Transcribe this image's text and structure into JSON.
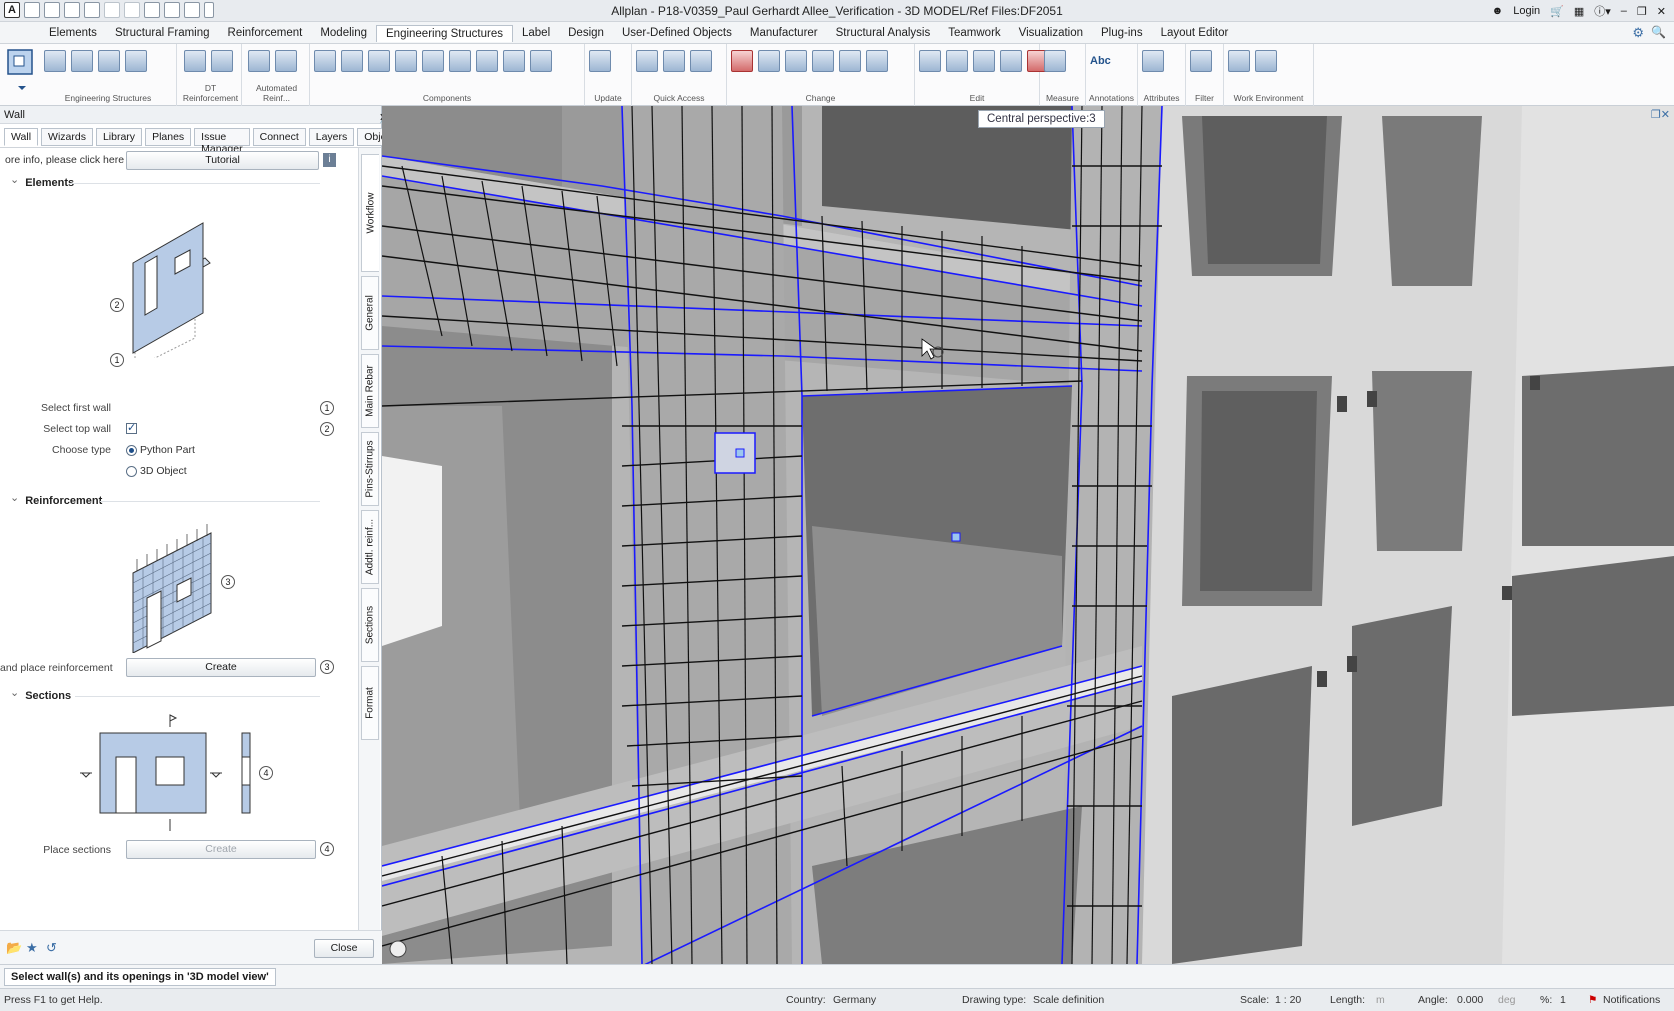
{
  "window": {
    "title": "Allplan - P18-V0359_Paul Gerhardt Allee_Verification - 3D MODEL/Ref Files:DF2051",
    "login": "Login"
  },
  "menu": {
    "tabs": [
      "Elements",
      "Structural Framing",
      "Reinforcement",
      "Modeling",
      "Engineering Structures",
      "Label",
      "Design",
      "User-Defined Objects",
      "Manufacturer",
      "Structural Analysis",
      "Teamwork",
      "Visualization",
      "Plug-ins",
      "Layout Editor"
    ],
    "active_index": 4
  },
  "ribbon": {
    "groups": [
      "Engineering Structures",
      "DT Reinforcement",
      "Automated Reinf...",
      "Components",
      "Update",
      "Quick Access",
      "Change",
      "Edit",
      "Measure",
      "Annotations",
      "Attributes",
      "Filter",
      "Work Environment"
    ],
    "annotation_text": "Abc"
  },
  "palette": {
    "title": "Wall",
    "tabs": [
      "Wall",
      "Wizards",
      "Library",
      "Planes",
      "Issue Manager",
      "Connect",
      "Layers",
      "Objects"
    ],
    "side_tabs": [
      "Workflow",
      "General",
      "Main Rebar",
      "Pins-Stirrups",
      "Addtl. reinf...",
      "Sections",
      "Format"
    ],
    "info_text": "ore info, please click here",
    "tutorial_button": "Tutorial",
    "sections": {
      "elements": "Elements",
      "reinforcement": "Reinforcement",
      "sections": "Sections"
    },
    "elements": {
      "select_first_wall": "Select first wall",
      "select_top_wall": "Select top wall",
      "select_top_wall_checked": true,
      "choose_type": "Choose type",
      "type_options": [
        "Python Part",
        "3D Object"
      ],
      "selected_type": "Python Part"
    },
    "reinforcement": {
      "label": "and place reinforcement",
      "button": "Create"
    },
    "sections_block": {
      "label": "Place sections",
      "button": "Create"
    },
    "step_numbers": [
      "1",
      "2",
      "3",
      "4"
    ],
    "close_button": "Close"
  },
  "viewport": {
    "view_label": "Central perspective:3"
  },
  "prompt": {
    "text": "Select wall(s) and its openings in '3D model view'"
  },
  "status": {
    "help": "Press F1 to get Help.",
    "country_label": "Country:",
    "country": "Germany",
    "drawing_type_label": "Drawing type:",
    "drawing_type": "Scale definition",
    "scale_label": "Scale:",
    "scale": "1 : 20",
    "length_label": "Length:",
    "length_unit": "m",
    "angle_label": "Angle:",
    "angle": "0.000",
    "angle_unit": "deg",
    "percent_label": "%:",
    "percent": "1",
    "notifications": "Notifications"
  },
  "colors": {
    "selection_blue": "#1a1aff",
    "concrete_light": "#e4e4e4",
    "concrete_dark": "#8a8a8a",
    "rebar": "#111111",
    "palette_diagram_fill": "#b7cbe6"
  }
}
